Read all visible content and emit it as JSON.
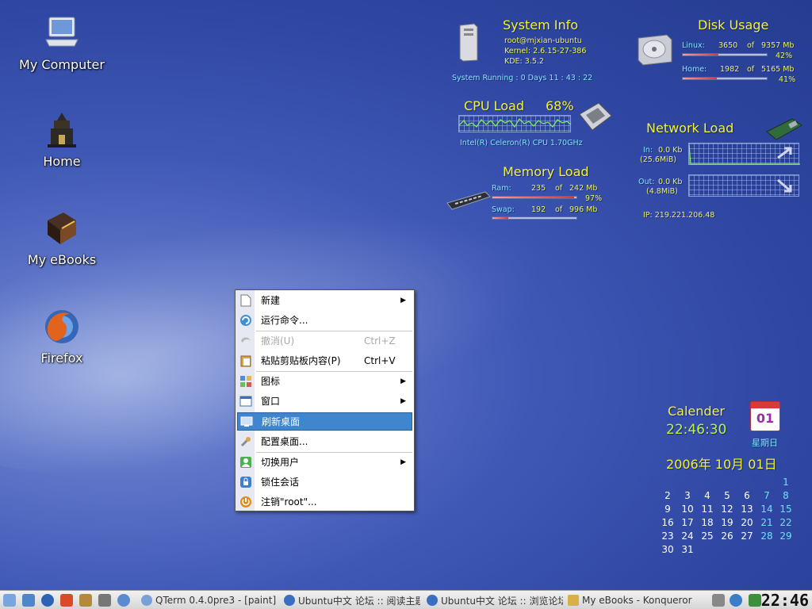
{
  "desktop": {
    "icons": [
      {
        "label": "My Computer"
      },
      {
        "label": "Home"
      },
      {
        "label": "My eBooks"
      },
      {
        "label": "Firefox"
      }
    ]
  },
  "system_info": {
    "title": "System Info",
    "user": "root@mjxian-ubuntu",
    "kernel": "Kernel: 2.6.15-27-386",
    "kde": "KDE: 3.5.2",
    "uptime": "System Running : 0 Days 11 : 43 : 22"
  },
  "disk_usage": {
    "title": "Disk Usage",
    "rows": [
      {
        "name": "Linux:",
        "used": "3650",
        "of": "of",
        "total": "9357 Mb",
        "percent": "42%",
        "fraction": 0.42
      },
      {
        "name": "Home:",
        "used": "1982",
        "of": "of",
        "total": "5165 Mb",
        "percent": "41%",
        "fraction": 0.41
      }
    ]
  },
  "cpu_load": {
    "title": "CPU Load",
    "percent": "68%",
    "cpu_name": "Intel(R) Celeron(R) CPU 1.70GHz"
  },
  "network_load": {
    "title": "Network Load",
    "in_label": "In:",
    "in_rate": "0.0 Kb",
    "in_total": "(25.6MiB)",
    "out_label": "Out:",
    "out_rate": "0.0 Kb",
    "out_total": "(4.8MiB)",
    "ip": "IP: 219.221.206.48"
  },
  "memory_load": {
    "title": "Memory Load",
    "ram_label": "Ram:",
    "ram_used": "235",
    "ram_of": "of",
    "ram_total": "242 Mb",
    "ram_percent": "97%",
    "ram_fraction": 0.97,
    "swap_label": "Swap:",
    "swap_used": "192",
    "swap_of": "of",
    "swap_total": "996 Mb",
    "swap_fraction": 0.19
  },
  "context_menu": {
    "items": [
      {
        "label": "新建",
        "shortcut": "",
        "submenu": true,
        "icon": "new-document-icon"
      },
      {
        "label": "运行命令...",
        "shortcut": "",
        "submenu": false,
        "icon": "run-command-icon"
      },
      {
        "label": "撤消(U)",
        "shortcut": "Ctrl+Z",
        "submenu": false,
        "icon": "undo-icon",
        "disabled": true
      },
      {
        "label": "粘贴剪贴板内容(P)",
        "shortcut": "Ctrl+V",
        "submenu": false,
        "icon": "paste-icon"
      },
      {
        "label": "图标",
        "shortcut": "",
        "submenu": true,
        "icon": "icons-icon"
      },
      {
        "label": "窗口",
        "shortcut": "",
        "submenu": true,
        "icon": "windows-icon"
      },
      {
        "label": "刷新桌面",
        "shortcut": "",
        "submenu": false,
        "icon": "refresh-desktop-icon",
        "selected": true
      },
      {
        "label": "配置桌面...",
        "shortcut": "",
        "submenu": false,
        "icon": "configure-icon"
      },
      {
        "label": "切换用户",
        "shortcut": "",
        "submenu": true,
        "icon": "switch-user-icon"
      },
      {
        "label": "锁住会话",
        "shortcut": "",
        "submenu": false,
        "icon": "lock-icon"
      },
      {
        "label": "注销\"root\"...",
        "shortcut": "",
        "submenu": false,
        "icon": "logout-icon"
      }
    ]
  },
  "calendar": {
    "title": "Calender",
    "time": "22:46:30",
    "day_badge": "01",
    "weekday": "星期日",
    "date": "2006年 10月 01日",
    "days": [
      "1",
      "2",
      "3",
      "4",
      "5",
      "6",
      "7",
      "8",
      "9",
      "10",
      "11",
      "12",
      "13",
      "14",
      "15",
      "16",
      "17",
      "18",
      "19",
      "20",
      "21",
      "22",
      "23",
      "24",
      "25",
      "26",
      "27",
      "28",
      "29",
      "30",
      "31"
    ]
  },
  "taskbar": {
    "tasks": [
      {
        "label": "QTerm 0.4.0pre3 - [paint]"
      },
      {
        "label": "Ubuntu中文 论坛 :: 阅读主题"
      },
      {
        "label": "Ubuntu中文 论坛 :: 浏览论坛"
      },
      {
        "label": "My eBooks - Konqueror"
      }
    ],
    "clock": "22:46"
  }
}
